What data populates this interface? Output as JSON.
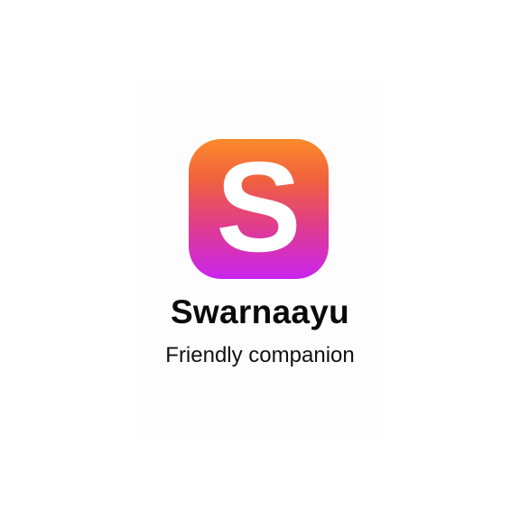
{
  "app": {
    "name": "Swarnaayu",
    "tagline": "Friendly companion",
    "icon_letter": "S",
    "icon": "app-logo-icon"
  },
  "colors": {
    "gradient_top": "#fb8a2a",
    "gradient_bottom": "#c925ee",
    "letter": "#ffffff",
    "title_text": "#0a0a0a",
    "background": "#ffffff"
  }
}
